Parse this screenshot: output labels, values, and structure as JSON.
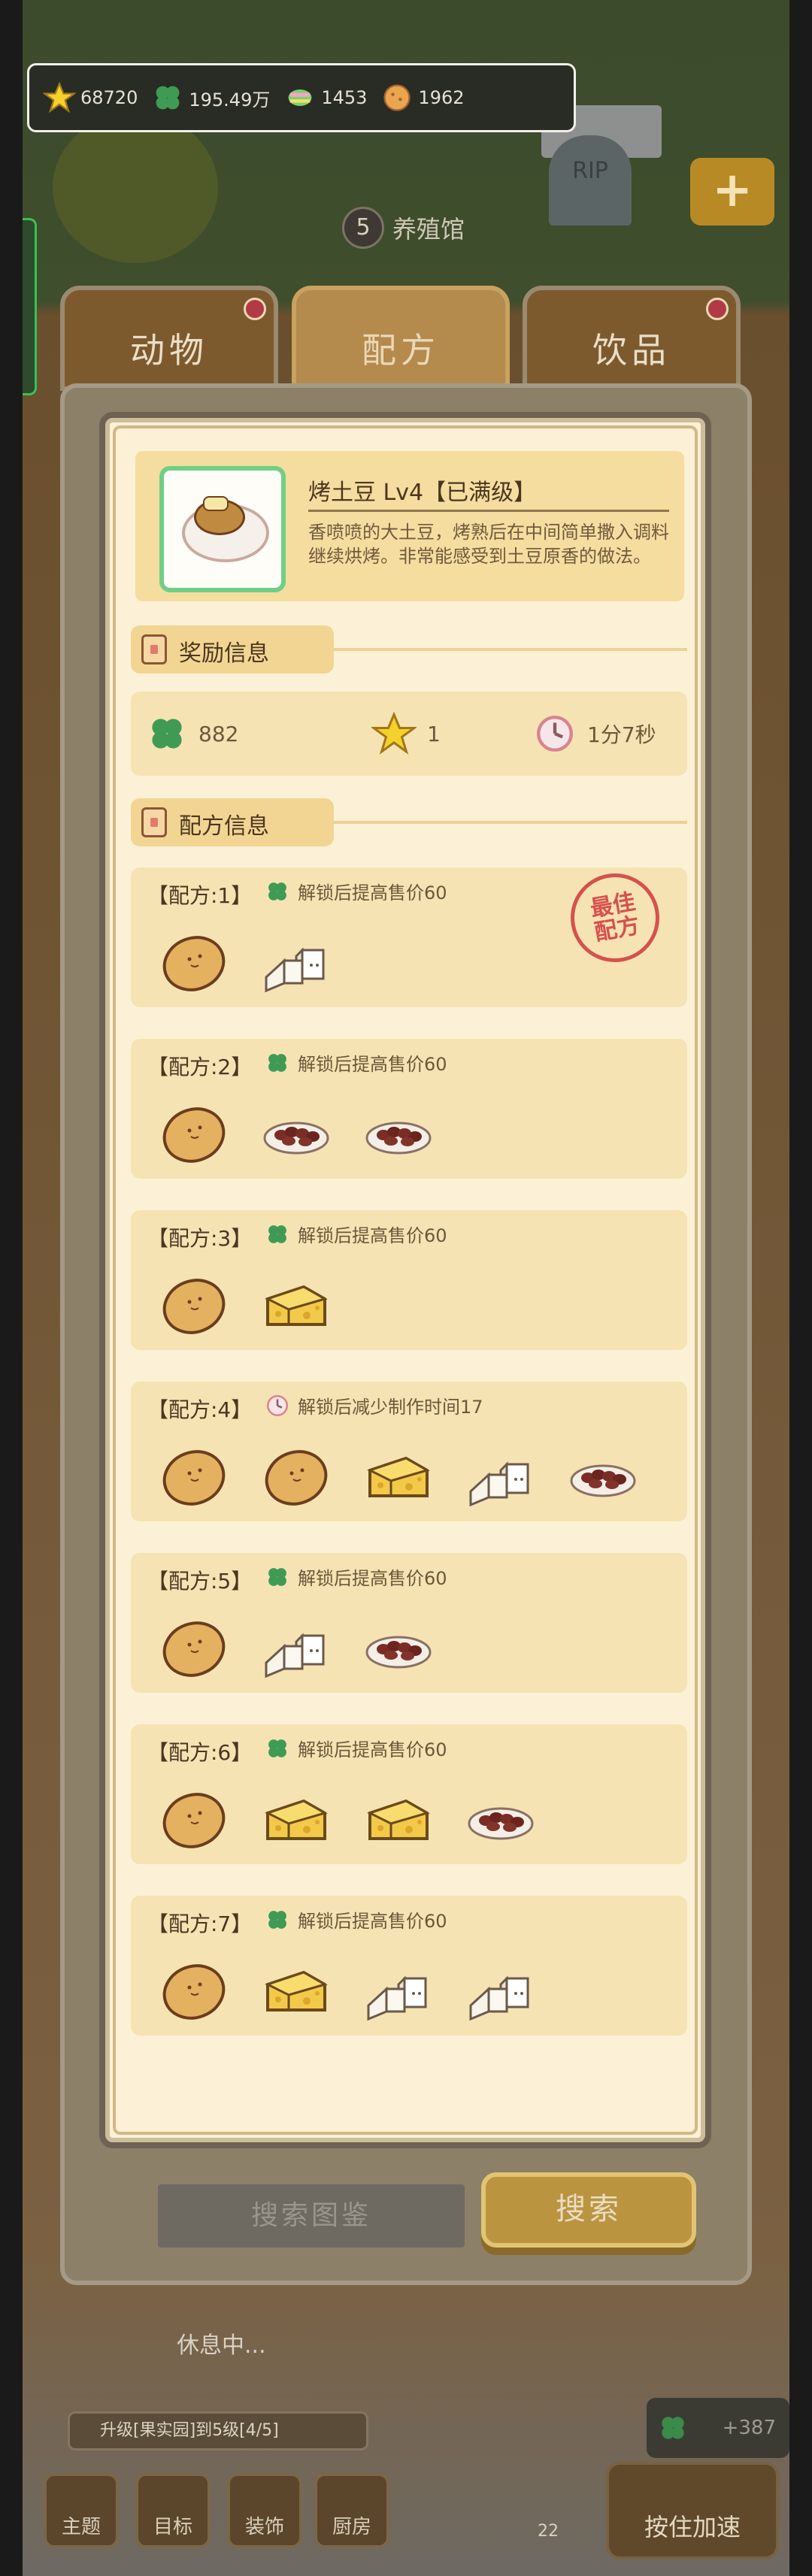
{
  "resources": [
    {
      "icon": "star-icon",
      "value": "68720"
    },
    {
      "icon": "clover-icon",
      "value": "195.49万"
    },
    {
      "icon": "candy-icon",
      "value": "1453"
    },
    {
      "icon": "cookie-icon",
      "value": "1962"
    }
  ],
  "scene": {
    "level": "5",
    "building": "养殖馆",
    "grave_text": "RIP"
  },
  "tabs": [
    {
      "label": "动物",
      "badge": true
    },
    {
      "label": "配方",
      "badge": false,
      "active": true
    },
    {
      "label": "饮品",
      "badge": true
    }
  ],
  "item": {
    "name": "烤土豆 Lv4【已满级】",
    "description": "香喷喷的大土豆，烤熟后在中间简单撒入调料继续烘烤。非常能感受到土豆原香的做法。"
  },
  "reward_section": {
    "label": "奖励信息"
  },
  "rewards": {
    "clover": "882",
    "star": "1",
    "time": "1分7秒"
  },
  "recipe_section": {
    "label": "配方信息"
  },
  "best_stamp": {
    "line1": "最佳",
    "line2": "配方"
  },
  "recipes": [
    {
      "title": "【配方:1】",
      "note": "解锁后提高售价60",
      "note_icon": "clover-icon",
      "ingredients": [
        "potato",
        "tofu"
      ],
      "best": true
    },
    {
      "title": "【配方:2】",
      "note": "解锁后提高售价60",
      "note_icon": "clover-icon",
      "ingredients": [
        "potato",
        "beans",
        "beans"
      ]
    },
    {
      "title": "【配方:3】",
      "note": "解锁后提高售价60",
      "note_icon": "clover-icon",
      "ingredients": [
        "potato",
        "cheese"
      ]
    },
    {
      "title": "【配方:4】",
      "note": "解锁后减少制作时间17",
      "note_icon": "clock-icon",
      "ingredients": [
        "potato",
        "potato",
        "cheese",
        "tofu",
        "beans"
      ]
    },
    {
      "title": "【配方:5】",
      "note": "解锁后提高售价60",
      "note_icon": "clover-icon",
      "ingredients": [
        "potato",
        "tofu",
        "beans"
      ]
    },
    {
      "title": "【配方:6】",
      "note": "解锁后提高售价60",
      "note_icon": "clover-icon",
      "ingredients": [
        "potato",
        "cheese",
        "cheese",
        "beans"
      ]
    },
    {
      "title": "【配方:7】",
      "note": "解锁后提高售价60",
      "note_icon": "clover-icon",
      "ingredients": [
        "potato",
        "cheese",
        "tofu",
        "tofu"
      ]
    }
  ],
  "buttons": {
    "search_catalog": "搜索图鉴",
    "search": "搜索"
  },
  "hud": {
    "status": "休息中...",
    "upgrade": "升级[果实园]到5级[4/5]",
    "menu": [
      "主题",
      "目标",
      "装饰",
      "厨房"
    ],
    "clover_bonus": "+387",
    "counter": "22",
    "speed": "按住加速"
  },
  "colors": {
    "panel_cream": "#fcf1d6",
    "header_gold": "#f5dd9f",
    "section_gold": "#f2d592",
    "accent_green": "#6fcf87",
    "stamp_red": "#d6514e"
  }
}
